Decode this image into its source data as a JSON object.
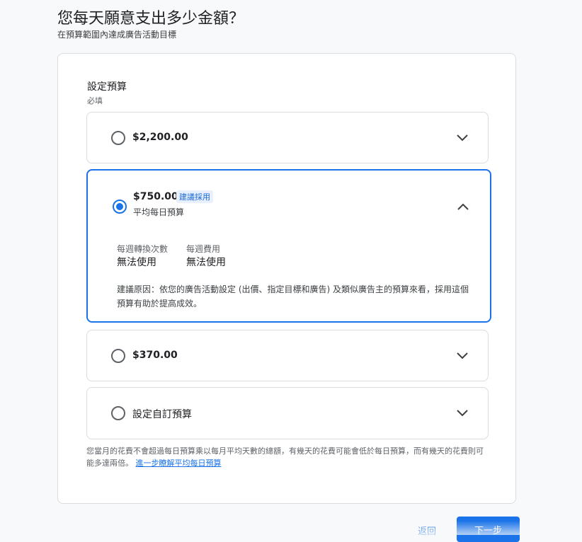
{
  "header": {
    "title": "您每天願意支出多少金額？",
    "subtitle": "在預算範圍內達成廣告活動目標"
  },
  "budget": {
    "section_title": "設定預算",
    "required": "必填",
    "options": [
      {
        "amount": "$2,200.00",
        "selected": false,
        "expanded": false
      },
      {
        "amount": "$750.00",
        "badge": "建議採用",
        "sub": "平均每日預算",
        "selected": true,
        "expanded": true,
        "stats": [
          {
            "label": "每週轉換次數",
            "value": "無法使用"
          },
          {
            "label": "每週費用",
            "value": "無法使用"
          }
        ],
        "reason": "建議原因：依您的廣告活動設定 (出價、指定目標和廣告) 及類似廣告主的預算來看，採用這個預算有助於提高成效。"
      },
      {
        "amount": "$370.00",
        "selected": false,
        "expanded": false
      },
      {
        "amount": "設定自訂預算",
        "selected": false,
        "expanded": false
      }
    ],
    "footnote_text": "您當月的花費不會超過每日預算乘以每月平均天數的總額，有幾天的花費可能會低於每日預算，而有幾天的花費則可能多達兩倍。",
    "footnote_link": "進一步瞭解平均每日預算"
  },
  "actions": {
    "back_label": "返回",
    "next_label": "下一步"
  },
  "colors": {
    "accent": "#1a73e8",
    "badge_bg": "#e8f0fe"
  }
}
